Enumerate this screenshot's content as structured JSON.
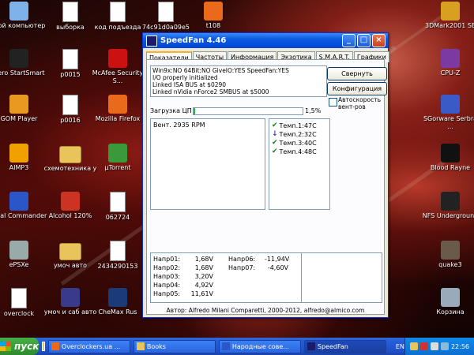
{
  "desktop": {
    "icons_left": [
      {
        "label": "Мой компьютер",
        "icon": "my-computer-icon"
      },
      {
        "label": "Nero StartSmart",
        "icon": "nero-icon"
      },
      {
        "label": "GOM Player",
        "icon": "gom-player-icon"
      },
      {
        "label": "AIMP3",
        "icon": "aimp-icon"
      },
      {
        "label": "Total Commander",
        "icon": "total-commander-icon"
      },
      {
        "label": "ePSXe",
        "icon": "epsxe-icon"
      },
      {
        "label": "overclock",
        "icon": "document-icon"
      }
    ],
    "icons_col2": [
      {
        "label": "выборка",
        "icon": "document-icon"
      },
      {
        "label": "p0015",
        "icon": "image-file-icon"
      },
      {
        "label": "p0016",
        "icon": "image-file-icon"
      },
      {
        "label": "схемотехника у",
        "icon": "folder-icon"
      },
      {
        "label": "Alcohol 120%",
        "icon": "alcohol-icon"
      },
      {
        "label": "умоч авто",
        "icon": "folder-icon"
      },
      {
        "label": "умоч и саб авто",
        "icon": "winamp-icon"
      }
    ],
    "icons_col3": [
      {
        "label": "код подъезда",
        "icon": "document-icon"
      },
      {
        "label": "McAfee Security S...",
        "icon": "mcafee-icon"
      },
      {
        "label": "Mozilla Firefox",
        "icon": "firefox-icon"
      },
      {
        "label": "µTorrent",
        "icon": "utorrent-icon"
      },
      {
        "label": "062724",
        "icon": "pdf-icon"
      },
      {
        "label": "2434290153",
        "icon": "image-file-icon"
      },
      {
        "label": "CheMax Rus",
        "icon": "chemax-icon"
      }
    ],
    "icons_top": [
      {
        "label": "74c91d0a09e5",
        "icon": "image-file-icon"
      },
      {
        "label": "t108",
        "icon": "firefox-icon"
      }
    ],
    "icons_right": [
      {
        "label": "3DMark2001 SE",
        "icon": "3dmark-icon"
      },
      {
        "label": "CPU-Z",
        "icon": "cpuz-icon"
      },
      {
        "label": "SGorware Serbra ...",
        "icon": "sgorware-icon"
      },
      {
        "label": "Blood Rayne",
        "icon": "bloodrayne-icon"
      },
      {
        "label": "NFS Underground",
        "icon": "nfs-icon"
      },
      {
        "label": "quake3",
        "icon": "quake-icon"
      },
      {
        "label": "Корзина",
        "icon": "recycle-bin-icon"
      }
    ]
  },
  "window": {
    "title": "SpeedFan 4.46",
    "tabs": [
      "Показатели",
      "Частоты",
      "Информация",
      "Экзотика",
      "S.M.A.R.T.",
      "Графики"
    ],
    "log_lines": [
      "Win9x:NO  64Bit:NO  GiveIO:YES  SpeedFan:YES",
      "I/O properly initialized",
      "Linked ISA BUS at $0290",
      "Linked nVidia nForce2 SMBUS at $5000"
    ],
    "minimize_button": "Свернуть",
    "configure_button": "Конфигурация",
    "autospeed_label_1": "Автоскорость",
    "autospeed_label_2": "вент-ров",
    "autospeed_checked": false,
    "cpu_load_label": "Загрузка ЦП",
    "cpu_load_percent": 1.5,
    "cpu_load_text": "1,5%",
    "fans": [
      {
        "text": "Вент. 2935 RPM"
      }
    ],
    "temps": [
      {
        "text": "Темп.1:47C",
        "status": "ok"
      },
      {
        "text": "Темп.2:32C",
        "status": "down"
      },
      {
        "text": "Темп.3:40C",
        "status": "ok"
      },
      {
        "text": "Темп.4:48C",
        "status": "ok"
      }
    ],
    "voltages_col1": [
      {
        "name": "Напр01:",
        "value": "1,68V"
      },
      {
        "name": "Напр02:",
        "value": "1,68V"
      },
      {
        "name": "Напр03:",
        "value": "3,20V"
      },
      {
        "name": "Напр04:",
        "value": "4,92V"
      },
      {
        "name": "Напр05:",
        "value": "11,61V"
      }
    ],
    "voltages_col2": [
      {
        "name": "Напр06:",
        "value": "-11,94V"
      },
      {
        "name": "Напр07:",
        "value": "-4,60V"
      }
    ],
    "status": "Автор: Alfredo Milani Comparetti, 2000-2012, alfredo@almico.com"
  },
  "taskbar": {
    "start": "пуск",
    "tasks": [
      {
        "label": "Overclockers.ua ...",
        "icon": "firefox-icon"
      },
      {
        "label": "Books",
        "icon": "folder-icon"
      },
      {
        "label": "Народные сове...",
        "icon": "word-icon"
      },
      {
        "label": "SpeedFan",
        "icon": "speedfan-icon"
      }
    ],
    "lang": "EN",
    "clock": "22:56"
  },
  "colors": {
    "titlebar": "#0a5ae0",
    "taskbar": "#245edb",
    "start": "#2e8a2e",
    "load_bar": "#2fbd2f"
  }
}
